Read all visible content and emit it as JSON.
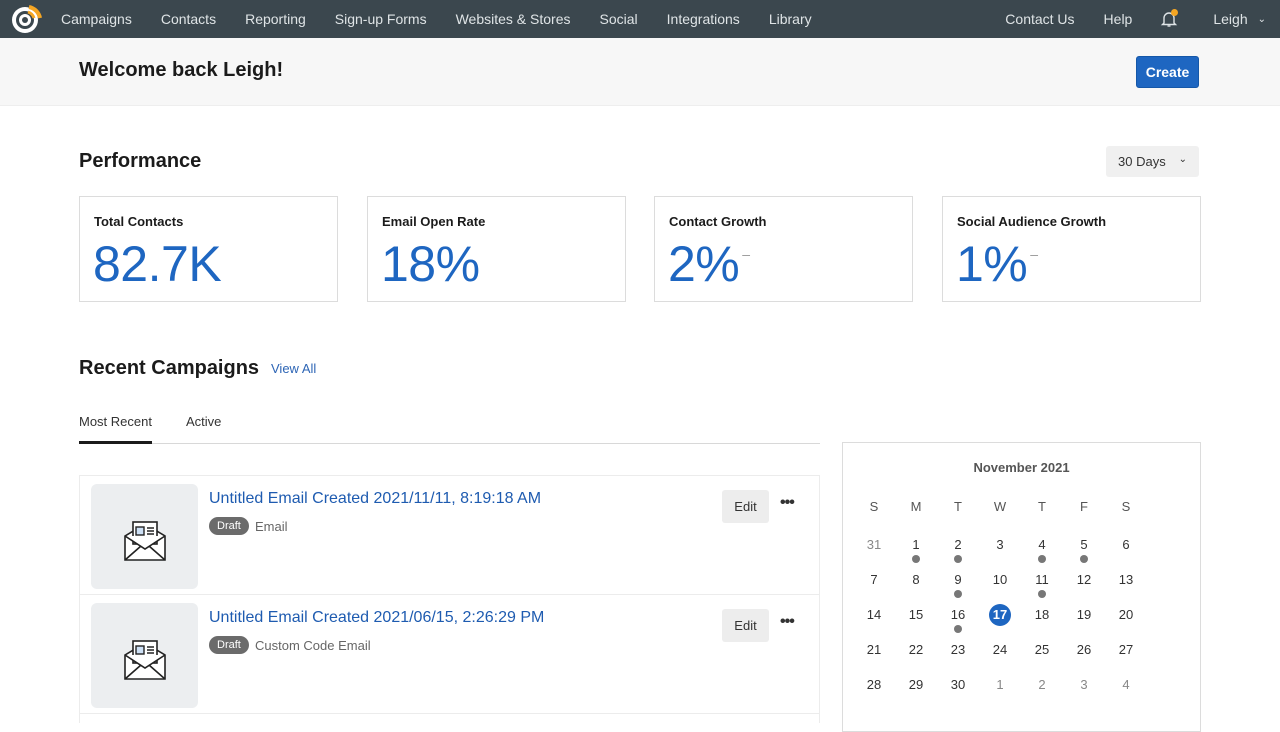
{
  "nav": {
    "items": [
      "Campaigns",
      "Contacts",
      "Reporting",
      "Sign-up Forms",
      "Websites & Stores",
      "Social",
      "Integrations",
      "Library"
    ],
    "contact_us": "Contact Us",
    "help": "Help",
    "user": "Leigh",
    "has_notification": true,
    "accent_color": "#f5a623"
  },
  "header": {
    "welcome": "Welcome back Leigh!",
    "create_label": "Create"
  },
  "performance": {
    "title": "Performance",
    "range": "30 Days",
    "cards": [
      {
        "label": "Total Contacts",
        "value": "82.7K",
        "trend": ""
      },
      {
        "label": "Email Open Rate",
        "value": "18%",
        "trend": ""
      },
      {
        "label": "Contact Growth",
        "value": "2%",
        "trend": "–"
      },
      {
        "label": "Social Audience Growth",
        "value": "1%",
        "trend": "–"
      }
    ]
  },
  "recent": {
    "title": "Recent Campaigns",
    "view_all": "View All",
    "tabs": [
      "Most Recent",
      "Active"
    ],
    "active_tab": 0,
    "campaigns": [
      {
        "title": "Untitled Email Created 2021/11/11, 8:19:18 AM",
        "status": "Draft",
        "type": "Email",
        "edit": "Edit",
        "more": "•••"
      },
      {
        "title": "Untitled Email Created 2021/06/15, 2:26:29 PM",
        "status": "Draft",
        "type": "Custom Code Email",
        "edit": "Edit",
        "more": "•••"
      }
    ]
  },
  "calendar": {
    "title": "November 2021",
    "weekdays": [
      "S",
      "M",
      "T",
      "W",
      "T",
      "F",
      "S"
    ],
    "today": 17,
    "weeks": [
      [
        {
          "d": "31",
          "muted": true
        },
        {
          "d": "1",
          "dot": true
        },
        {
          "d": "2",
          "dot": true
        },
        {
          "d": "3"
        },
        {
          "d": "4",
          "dot": true
        },
        {
          "d": "5",
          "dot": true
        },
        {
          "d": "6"
        }
      ],
      [
        {
          "d": "7"
        },
        {
          "d": "8"
        },
        {
          "d": "9",
          "dot": true
        },
        {
          "d": "10"
        },
        {
          "d": "11",
          "dot": true
        },
        {
          "d": "12"
        },
        {
          "d": "13"
        }
      ],
      [
        {
          "d": "14"
        },
        {
          "d": "15"
        },
        {
          "d": "16",
          "dot": true
        },
        {
          "d": "17",
          "today": true
        },
        {
          "d": "18"
        },
        {
          "d": "19"
        },
        {
          "d": "20"
        }
      ],
      [
        {
          "d": "21"
        },
        {
          "d": "22"
        },
        {
          "d": "23"
        },
        {
          "d": "24"
        },
        {
          "d": "25"
        },
        {
          "d": "26"
        },
        {
          "d": "27"
        }
      ],
      [
        {
          "d": "28"
        },
        {
          "d": "29"
        },
        {
          "d": "30"
        },
        {
          "d": "1",
          "muted": true
        },
        {
          "d": "2",
          "muted": true
        },
        {
          "d": "3",
          "muted": true
        },
        {
          "d": "4",
          "muted": true
        }
      ]
    ]
  }
}
